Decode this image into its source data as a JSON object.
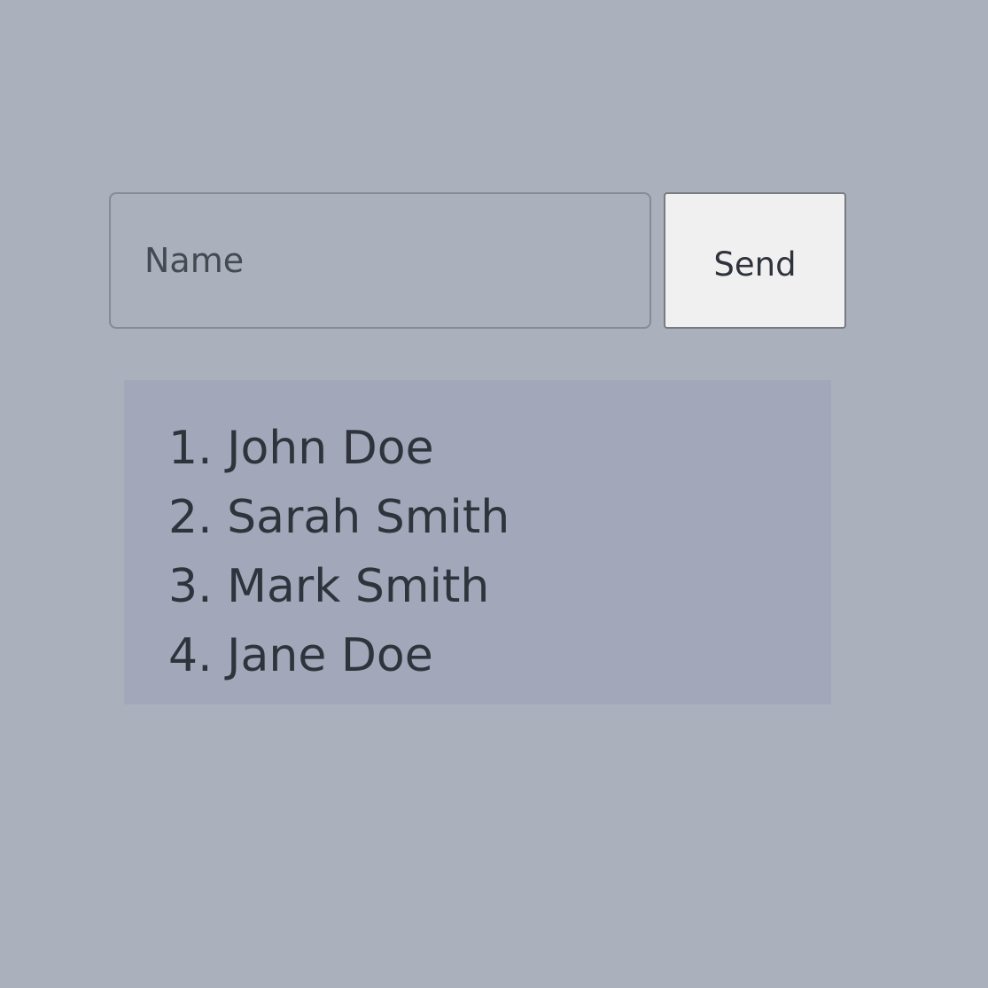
{
  "form": {
    "name_placeholder": "Name",
    "name_value": "",
    "send_label": "Send"
  },
  "names": {
    "items": [
      {
        "number": "1.",
        "label": "John Doe"
      },
      {
        "number": "2.",
        "label": "Sarah Smith"
      },
      {
        "number": "3.",
        "label": "Mark Smith"
      },
      {
        "number": "4.",
        "label": "Jane Doe"
      }
    ]
  },
  "colors": {
    "page_background": "#aab0bc",
    "list_background": "#a2a8ba",
    "button_background": "#f0f0f0",
    "text": "#2f333b"
  }
}
